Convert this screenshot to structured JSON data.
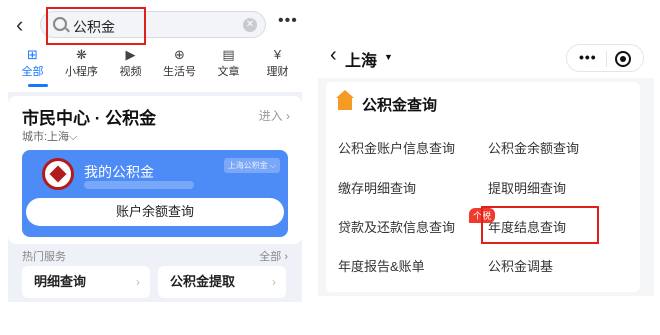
{
  "left": {
    "search_query": "公积金",
    "tabs": [
      {
        "icon": "⊞",
        "label": "全部"
      },
      {
        "icon": "❋",
        "label": "小程序"
      },
      {
        "icon": "▶",
        "label": "视频"
      },
      {
        "icon": "⊕",
        "label": "生活号"
      },
      {
        "icon": "▤",
        "label": "文章"
      },
      {
        "icon": "¥",
        "label": "理财"
      }
    ],
    "card_title": "市民中心 · 公积金",
    "card_enter": "进入 ›",
    "city_label": "城市:上海⌵",
    "my_fund": "我的公积金",
    "city_pill": "上海公积金 ⌵",
    "balance_button": "账户余额查询",
    "hot_services": "热门服务",
    "all_label": "全部 ›",
    "services": [
      "明细查询",
      "公积金提取"
    ]
  },
  "right": {
    "city": "上海",
    "card_title": "公积金查询",
    "items": [
      "公积金账户信息查询",
      "公积金余额查询",
      "缴存明细查询",
      "提取明细查询",
      "贷款及还款信息查询",
      "年度结息查询",
      "年度报告&账单",
      "公积金调基"
    ],
    "tag": "个税"
  }
}
